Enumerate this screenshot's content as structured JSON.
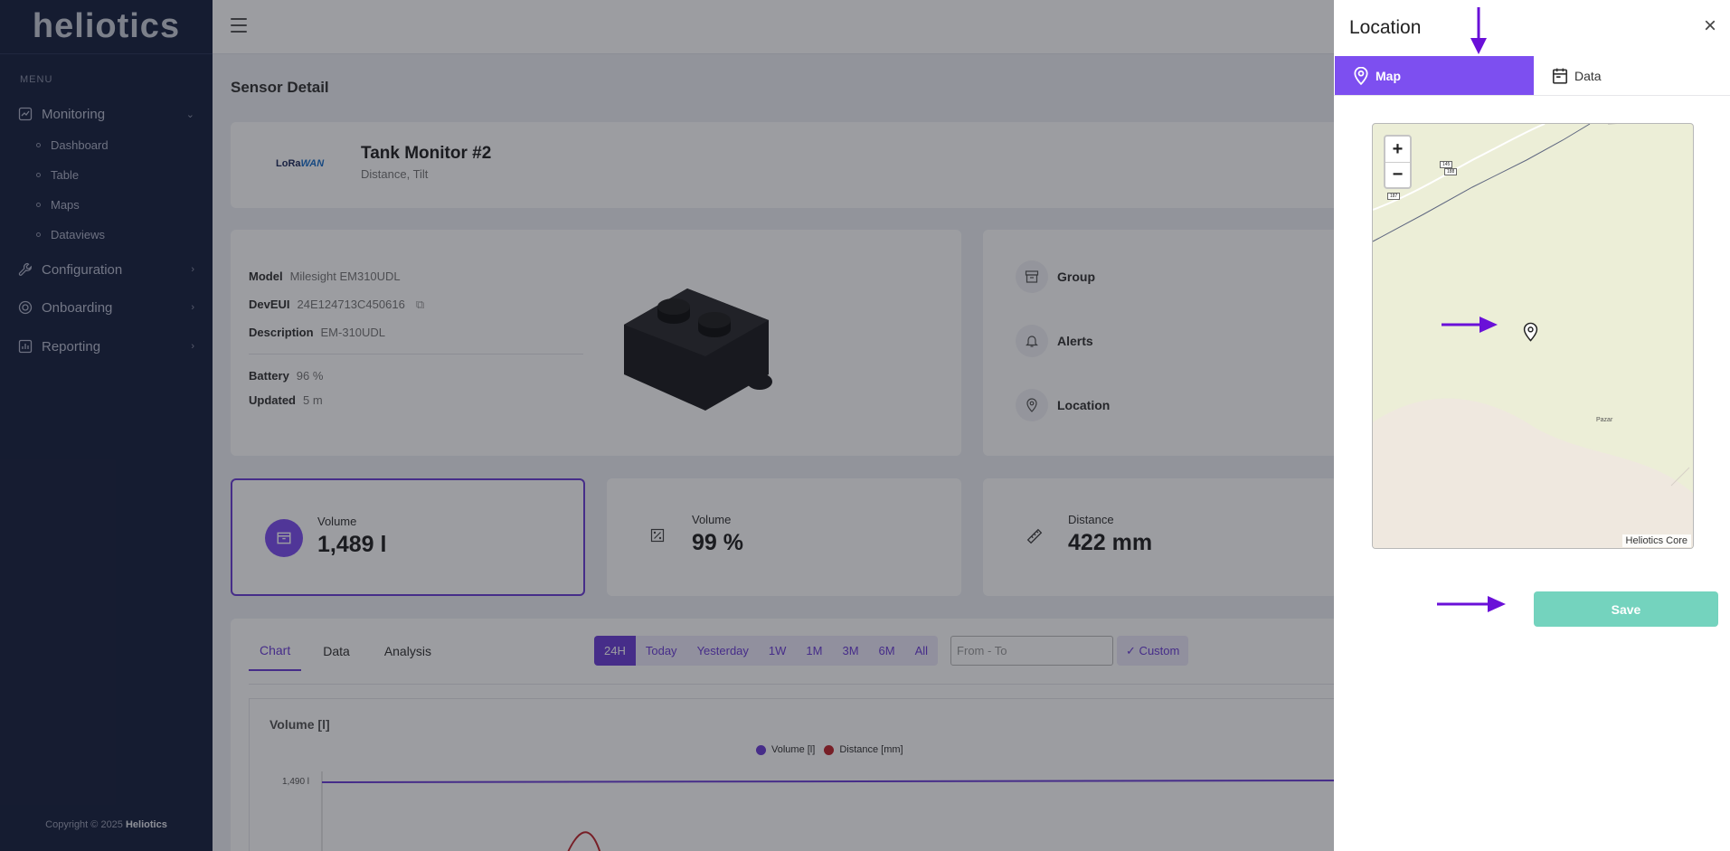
{
  "sidebar": {
    "logo": "heliotics",
    "menu_title": "MENU",
    "items": [
      {
        "label": "Monitoring"
      },
      {
        "label": "Configuration"
      },
      {
        "label": "Onboarding"
      },
      {
        "label": "Reporting"
      }
    ],
    "sub_items": [
      {
        "label": "Dashboard"
      },
      {
        "label": "Table"
      },
      {
        "label": "Maps"
      },
      {
        "label": "Dataviews"
      }
    ],
    "copyright_prefix": "Copyright © 2025",
    "copyright_brand": "Heliotics"
  },
  "page": {
    "title": "Sensor Detail",
    "device": {
      "brand": "LoRaWAN",
      "name": "Tank Monitor #2",
      "subtitle": "Distance, Tilt"
    },
    "details": {
      "model_label": "Model",
      "model_value": "Milesight EM310UDL",
      "deveui_label": "DevEUI",
      "deveui_value": "24E124713C450616",
      "description_label": "Description",
      "description_value": "EM-310UDL",
      "battery_label": "Battery",
      "battery_value": "96 %",
      "updated_label": "Updated",
      "updated_value": "5 m"
    },
    "side_items": [
      {
        "label": "Group"
      },
      {
        "label": "Alerts"
      },
      {
        "label": "Location"
      }
    ],
    "metrics": [
      {
        "label": "Volume",
        "value": "1,489 l"
      },
      {
        "label": "Volume",
        "value": "99 %"
      },
      {
        "label": "Distance",
        "value": "422 mm"
      }
    ],
    "tabs": [
      {
        "label": "Chart"
      },
      {
        "label": "Data"
      },
      {
        "label": "Analysis"
      }
    ],
    "ranges": [
      "24H",
      "Today",
      "Yesterday",
      "1W",
      "1M",
      "3M",
      "6M",
      "All"
    ],
    "date_placeholder": "From - To",
    "custom_label": "✓ Custom",
    "chart": {
      "title": "Volume [l]",
      "legend": [
        "Volume [l]",
        "Distance [mm]"
      ],
      "y_tick": "1,490 l",
      "colors": {
        "volume": "#6c3fd6",
        "distance": "#c0262d"
      }
    }
  },
  "panel": {
    "title": "Location",
    "tabs": [
      {
        "label": "Map"
      },
      {
        "label": "Data"
      }
    ],
    "map": {
      "zoom_in": "+",
      "zoom_out": "−",
      "attribution": "Heliotics Core",
      "place_label": "Pazar",
      "road_labels": [
        "145",
        "188",
        "187"
      ]
    },
    "save_label": "Save"
  },
  "colors": {
    "accent": "#7d4ff0",
    "save": "#74d3be",
    "sidebar": "#18213f",
    "arrow": "#6a10d8"
  }
}
